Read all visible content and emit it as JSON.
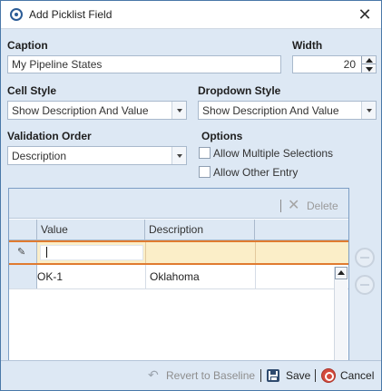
{
  "window": {
    "title": "Add Picklist Field",
    "close_glyph": "✕"
  },
  "form": {
    "caption_label": "Caption",
    "caption_value": "My Pipeline States",
    "width_label": "Width",
    "width_value": "20",
    "cell_style_label": "Cell Style",
    "cell_style_value": "Show Description And Value",
    "dropdown_style_label": "Dropdown Style",
    "dropdown_style_value": "Show Description And Value",
    "validation_order_label": "Validation Order",
    "validation_order_value": "Description",
    "options_label": "Options",
    "allow_multiple_label": "Allow Multiple Selections",
    "allow_multiple_checked": false,
    "allow_other_label": "Allow Other Entry",
    "allow_other_checked": false
  },
  "grid": {
    "delete_label": "Delete",
    "columns": [
      "Value",
      "Description"
    ],
    "edit_row": {
      "value": "",
      "description": ""
    },
    "rows": [
      {
        "value": "OK-1",
        "description": "Oklahoma"
      }
    ]
  },
  "footer": {
    "revert_label": "Revert to Baseline",
    "save_label": "Save",
    "cancel_label": "Cancel"
  }
}
